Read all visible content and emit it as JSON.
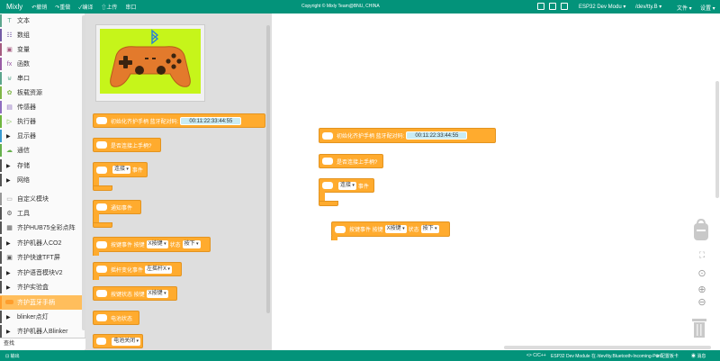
{
  "topbar": {
    "app_name": "Mixly",
    "undo": "↶撤销",
    "redo": "↷重做",
    "compile": "✓编译",
    "upload": "⇧上传",
    "serial": "串口",
    "copyright": "Copyright © Mixly Team@BNU, CHINA",
    "board": "ESP32 Dev Modu ▾",
    "port": "/dev/tty.B ▾",
    "file_menu": "文件 ▾",
    "settings_menu": "设置 ▾"
  },
  "sidebar": {
    "items": [
      {
        "label": "文本",
        "color": "#5ca68d",
        "icon": "T"
      },
      {
        "label": "数组",
        "color": "#745ba5",
        "icon": "☷"
      },
      {
        "label": "变量",
        "color": "#a55b80",
        "icon": "▣"
      },
      {
        "label": "函数",
        "color": "#995ba5",
        "icon": "fx"
      },
      {
        "label": "串口",
        "color": "#5ba58c",
        "icon": "⊎"
      },
      {
        "label": "板载资源",
        "color": "#7fb547",
        "icon": "✿"
      },
      {
        "label": "传感器",
        "color": "#8e6dbf",
        "icon": "▤"
      },
      {
        "label": "执行器",
        "color": "#6fb53c",
        "icon": "▷"
      },
      {
        "label": "显示器",
        "color": "#3a9bd1",
        "icon": "▶"
      },
      {
        "label": "通信",
        "color": "#66b04c",
        "icon": "☁"
      },
      {
        "label": "存储",
        "color": "#555555",
        "icon": "▶"
      },
      {
        "label": "网络",
        "color": "#555555",
        "icon": "▶"
      },
      {
        "label": "自定义模块",
        "color": "#999999",
        "icon": "▭"
      },
      {
        "label": "工具",
        "color": "#555555",
        "icon": "⚙"
      },
      {
        "label": "齐护HUB75全彩点阵",
        "color": "#555555",
        "icon": "▦"
      },
      {
        "label": "齐护机器人CO2",
        "color": "#555555",
        "icon": "▶"
      },
      {
        "label": "齐护快速TFT屏",
        "color": "#555555",
        "icon": "▣"
      },
      {
        "label": "齐护语音模块V2",
        "color": "#555555",
        "icon": "▶"
      },
      {
        "label": "齐护实验盒",
        "color": "#555555",
        "icon": "▶"
      },
      {
        "label": "齐护蓝牙手柄",
        "color": "#ff9e2c",
        "icon": "gamepad",
        "selected": true
      },
      {
        "label": "blinker点灯",
        "color": "#555555",
        "icon": "▶"
      },
      {
        "label": "齐护机器人Blinker",
        "color": "#555555",
        "icon": "▶"
      }
    ],
    "search_label": "查找"
  },
  "flyout": {
    "init_label": "初始化齐护手柄 蓝牙配对码:",
    "mac": "00:11:22:33:44:55",
    "connected_label": "是否连接上手柄?",
    "connect_label": "连接",
    "event_label": "事件",
    "notify_label": "通知事件",
    "button_event_label": "按键事件 按键",
    "button_value": "X按键",
    "state_label": "状态",
    "state_value": "按下",
    "joystick_event_label": "摇杆变化事件",
    "joystick_value": "左摇杆X",
    "button_state_label": "按键状态 按键",
    "battery_label": "电池状态",
    "battery_close_label": "电池关闭"
  },
  "workspace": {
    "init_label": "初始化齐护手柄 蓝牙配对码:",
    "mac": "00:11:22:33:44:55",
    "connected_label": "是否连接上手柄?",
    "connect_label": "连接",
    "event_label": "事件",
    "button_event_label": "按键事件 按键",
    "button_value": "X按键",
    "state_label": "状态",
    "state_value": "按下"
  },
  "statusbar": {
    "left": "⊡ 输出",
    "lang": "<> C/C++",
    "board_port": "ESP32 Dev Module 在 /dev/tty.Bluetooth-Incoming-Port",
    "config": "⚙ 配置板卡",
    "messages": "◉ 消息"
  },
  "colors": {
    "topbar": "#03937a",
    "block": "#ffab2e",
    "selected_category": "#ffbe5c",
    "image_background": "#c6f51a",
    "controller": "#e37a2c"
  }
}
